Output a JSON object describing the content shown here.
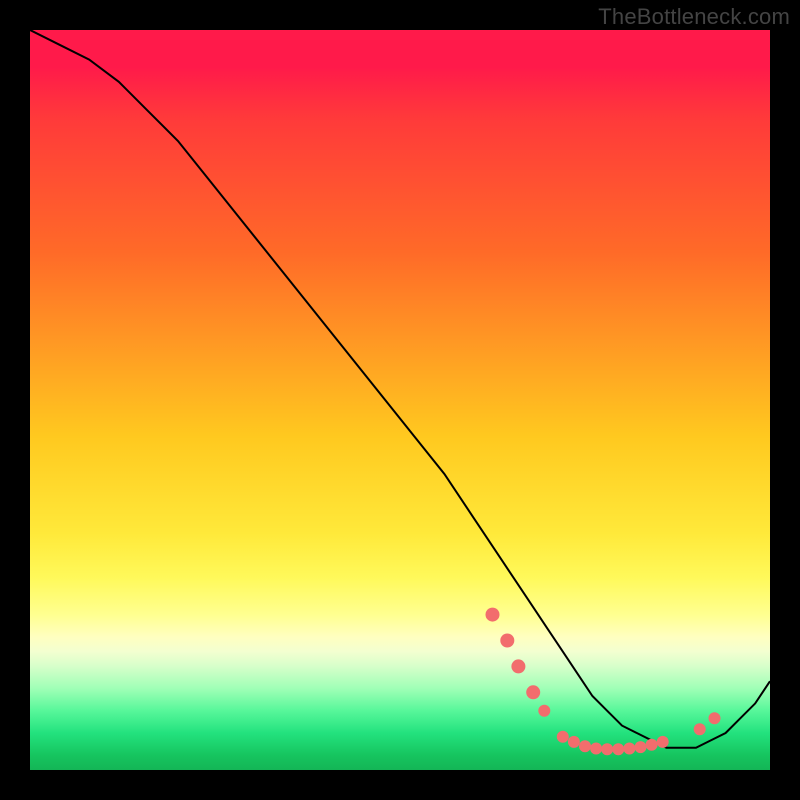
{
  "watermark": "TheBottleneck.com",
  "chart_data": {
    "type": "line",
    "title": "",
    "xlabel": "",
    "ylabel": "",
    "xlim": [
      0,
      100
    ],
    "ylim": [
      0,
      100
    ],
    "grid": false,
    "legend": false,
    "series": [
      {
        "name": "bottleneck-curve",
        "x": [
          0,
          4,
          8,
          12,
          16,
          20,
          24,
          28,
          32,
          36,
          40,
          44,
          48,
          52,
          56,
          60,
          64,
          68,
          70,
          72,
          74,
          76,
          78,
          80,
          82,
          84,
          86,
          88,
          90,
          92,
          94,
          96,
          98,
          100
        ],
        "y": [
          100,
          98,
          96,
          93,
          89,
          85,
          80,
          75,
          70,
          65,
          60,
          55,
          50,
          45,
          40,
          34,
          28,
          22,
          19,
          16,
          13,
          10,
          8,
          6,
          5,
          4,
          3,
          3,
          3,
          4,
          5,
          7,
          9,
          12
        ],
        "stroke": "#000000",
        "stroke_width": 2
      }
    ],
    "markers": [
      {
        "x": 62.5,
        "y": 21.0,
        "r": 7,
        "color": "#f26d6d"
      },
      {
        "x": 64.5,
        "y": 17.5,
        "r": 7,
        "color": "#f26d6d"
      },
      {
        "x": 66.0,
        "y": 14.0,
        "r": 7,
        "color": "#f26d6d"
      },
      {
        "x": 68.0,
        "y": 10.5,
        "r": 7,
        "color": "#f26d6d"
      },
      {
        "x": 69.5,
        "y": 8.0,
        "r": 6,
        "color": "#f26d6d"
      },
      {
        "x": 72.0,
        "y": 4.5,
        "r": 6,
        "color": "#f26d6d"
      },
      {
        "x": 73.5,
        "y": 3.8,
        "r": 6,
        "color": "#f26d6d"
      },
      {
        "x": 75.0,
        "y": 3.2,
        "r": 6,
        "color": "#f26d6d"
      },
      {
        "x": 76.5,
        "y": 2.9,
        "r": 6,
        "color": "#f26d6d"
      },
      {
        "x": 78.0,
        "y": 2.8,
        "r": 6,
        "color": "#f26d6d"
      },
      {
        "x": 79.5,
        "y": 2.8,
        "r": 6,
        "color": "#f26d6d"
      },
      {
        "x": 81.0,
        "y": 2.9,
        "r": 6,
        "color": "#f26d6d"
      },
      {
        "x": 82.5,
        "y": 3.1,
        "r": 6,
        "color": "#f26d6d"
      },
      {
        "x": 84.0,
        "y": 3.4,
        "r": 6,
        "color": "#f26d6d"
      },
      {
        "x": 85.5,
        "y": 3.8,
        "r": 6,
        "color": "#f26d6d"
      },
      {
        "x": 90.5,
        "y": 5.5,
        "r": 6,
        "color": "#f26d6d"
      },
      {
        "x": 92.5,
        "y": 7.0,
        "r": 6,
        "color": "#f26d6d"
      }
    ],
    "background_gradient": {
      "orientation": "vertical",
      "stops": [
        {
          "offset": 0.0,
          "color": "#ff1a4a"
        },
        {
          "offset": 0.3,
          "color": "#ff6a28"
        },
        {
          "offset": 0.55,
          "color": "#ffc91f"
        },
        {
          "offset": 0.74,
          "color": "#fff95a"
        },
        {
          "offset": 0.84,
          "color": "#f3ffd0"
        },
        {
          "offset": 0.92,
          "color": "#57f79a"
        },
        {
          "offset": 1.0,
          "color": "#14b556"
        }
      ]
    }
  }
}
